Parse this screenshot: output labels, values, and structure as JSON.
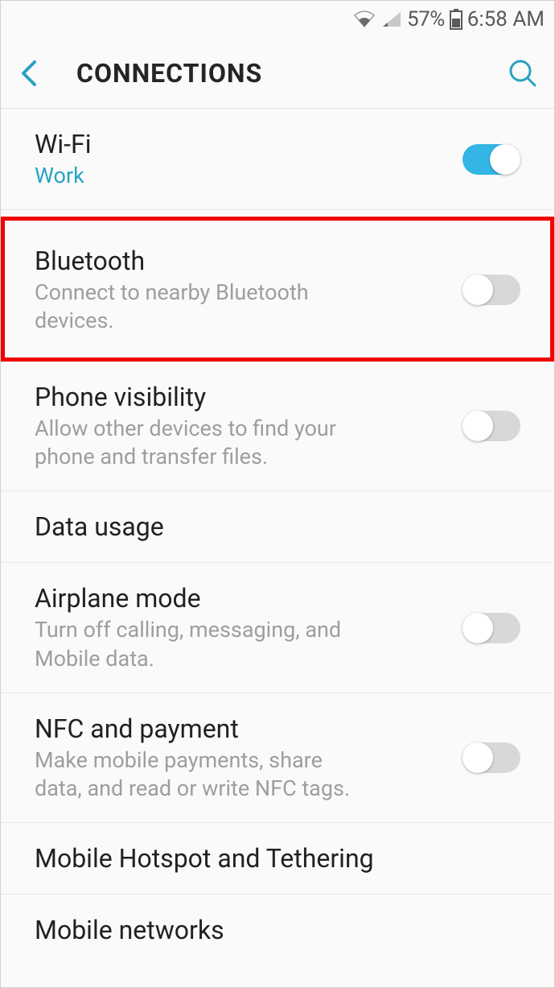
{
  "status_bar": {
    "battery_percent": "57%",
    "time": "6:58 AM"
  },
  "header": {
    "title": "CONNECTIONS"
  },
  "settings": {
    "wifi": {
      "title": "Wi-Fi",
      "subtitle": "Work",
      "toggle": true
    },
    "bluetooth": {
      "title": "Bluetooth",
      "subtitle": "Connect to nearby Bluetooth devices.",
      "toggle": false,
      "highlighted": true
    },
    "phone_visibility": {
      "title": "Phone visibility",
      "subtitle": "Allow other devices to find your phone and transfer files.",
      "toggle": false
    },
    "data_usage": {
      "title": "Data usage"
    },
    "airplane_mode": {
      "title": "Airplane mode",
      "subtitle": "Turn off calling, messaging, and Mobile data.",
      "toggle": false
    },
    "nfc": {
      "title": "NFC and payment",
      "subtitle": "Make mobile payments, share data, and read or write NFC tags.",
      "toggle": false
    },
    "hotspot": {
      "title": "Mobile Hotspot and Tethering"
    },
    "mobile_networks": {
      "title": "Mobile networks"
    }
  }
}
